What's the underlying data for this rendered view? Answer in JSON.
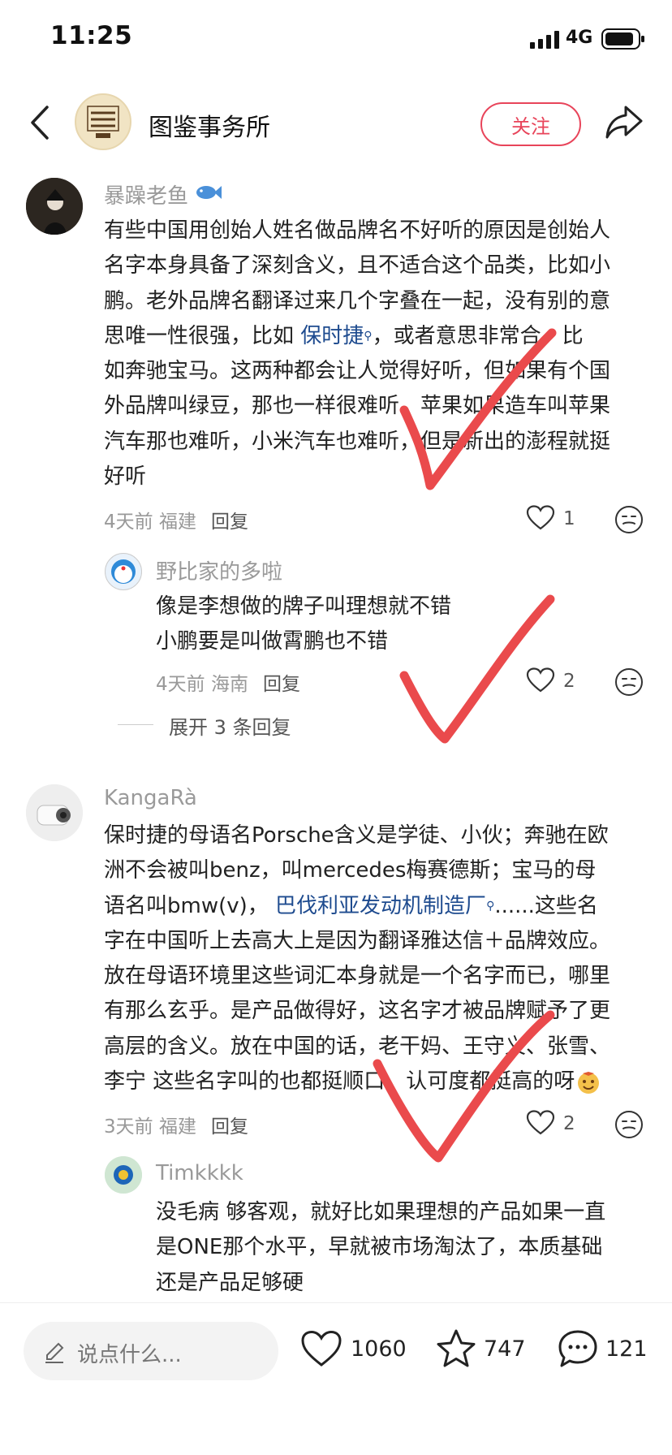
{
  "status_bar": {
    "time": "11:25",
    "network": "4G"
  },
  "header": {
    "account_name": "图鉴事务所",
    "follow_label": "关注",
    "back_icon": "chevron-left-icon",
    "share_icon": "share-icon"
  },
  "comments": [
    {
      "username": "暴躁老鱼",
      "badge_icon": "fish-icon",
      "lines": [
        "有些中国用创始人姓名做品牌名不好听的原因是创始人",
        "名字本身具备了深刻含义，且不适合这个品类，比如小",
        "鹏。老外品牌名翻译过来几个字叠在一起，没有别的意"
      ],
      "line4_pre": "思唯一性很强，比如",
      "link_text": "保时捷",
      "line4_post": "，或者意思非常合，比",
      "lines_after": [
        "如奔驰宝马。这两种都会让人觉得好听，但如果有个国",
        "外品牌叫绿豆，那也一样很难听，苹果如果造车叫苹果",
        "汽车那也难听，小米汽车也难听，但是新出的澎程就挺",
        "好听"
      ],
      "time": "4天前",
      "location": "福建",
      "reply_label": "回复",
      "likes": "1"
    },
    {
      "username": "野比家的多啦",
      "lines": [
        "像是李想做的牌子叫理想就不错",
        "小鹏要是叫做霄鹏也不错"
      ],
      "time": "4天前",
      "location": "海南",
      "reply_label": "回复",
      "likes": "2",
      "expand_label": "展开 3 条回复"
    },
    {
      "username": "KangaRà",
      "line1": "保时捷的母语名Porsche含义是学徒、小伙；奔驰在欧",
      "line2": "洲不会被叫benz，叫mercedes梅赛德斯；宝马的母",
      "line3_pre": "语名叫bmw(v)，",
      "link_text": "巴伐利亚发动机制造厂",
      "line3_post": "......这些名",
      "lines_after": [
        "字在中国听上去高大上是因为翻译雅达信＋品牌效应。",
        "放在母语环境里这些词汇本身就是一个名字而已，哪里",
        "有那么玄乎。是产品做得好，这名字才被品牌赋予了更",
        "高层的含义。放在中国的话，老干妈、王守义、张雪、",
        "李宁 这些名字叫的也都挺顺口，认可度都挺高的呀"
      ],
      "time": "3天前",
      "location": "福建",
      "reply_label": "回复",
      "likes": "2"
    },
    {
      "username": "Timkkkk",
      "lines": [
        "没毛病 够客观，就好比如果理想的产品如果一直",
        "是ONE那个水平，早就被市场淘汰了，本质基础",
        "还是产品足够硬"
      ]
    }
  ],
  "bottom_bar": {
    "input_placeholder": "说点什么...",
    "likes": "1060",
    "favorites": "747",
    "comments": "121"
  },
  "colors": {
    "accent": "#e8445a",
    "link": "#1e4b8f",
    "annotation": "#ea4a4c"
  }
}
